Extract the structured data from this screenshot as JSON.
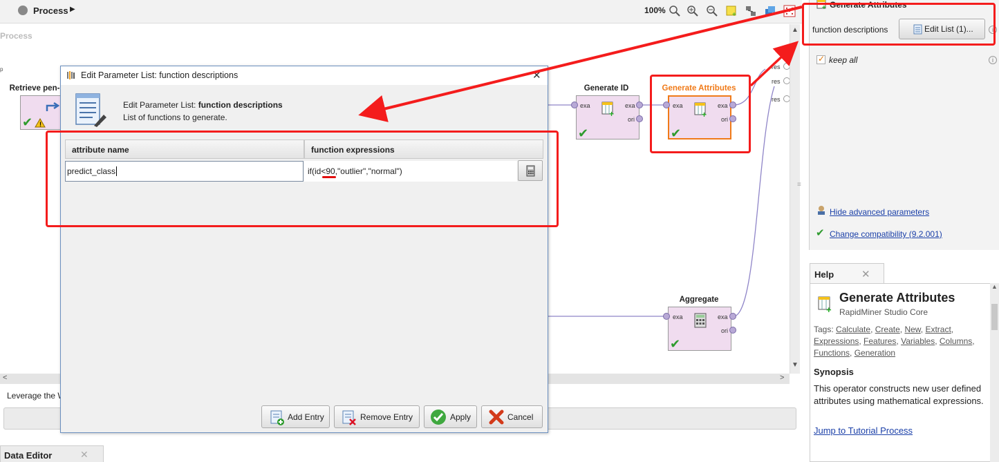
{
  "topbar": {
    "title": "Process",
    "zoom": "100%"
  },
  "canvas": {
    "label": "Process",
    "left_cut_label": "p",
    "operators": {
      "retrieve": {
        "title": "Retrieve pen-"
      },
      "generate_id": {
        "title": "Generate ID",
        "in_port": "exa",
        "out_ports": [
          "exa",
          "ori"
        ]
      },
      "generate_attributes": {
        "title": "Generate Attributes",
        "in_port": "exa",
        "out_ports": [
          "exa",
          "ori"
        ]
      },
      "aggregate": {
        "title": "Aggregate",
        "in_port": "exa",
        "out_ports": [
          "exa",
          "ori"
        ]
      }
    },
    "result_ports": [
      "res",
      "res",
      "res"
    ]
  },
  "bottom": {
    "leverage_text": "Leverage the W",
    "data_editor_tab": "Data Editor"
  },
  "params": {
    "header": "Generate Attributes",
    "function_descriptions_label": "function descriptions",
    "edit_list_button": "Edit List (1)...",
    "keep_all_label": "keep all",
    "keep_all_checked": true,
    "hide_advanced": "Hide advanced parameters",
    "change_compat": "Change compatibility (9.2.001)"
  },
  "help": {
    "tab": "Help",
    "title": "Generate Attributes",
    "subtitle": "RapidMiner Studio Core",
    "tags_prefix": "Tags:",
    "tags": [
      "Calculate",
      "Create",
      "New",
      "Extract",
      "Expressions",
      "Features",
      "Variables",
      "Columns",
      "Functions",
      "Generation"
    ],
    "synopsis_heading": "Synopsis",
    "synopsis": "This operator constructs new user defined attributes using mathematical expressions.",
    "tutorial_link": "Jump to Tutorial Process"
  },
  "dialog": {
    "title": "Edit Parameter List: function descriptions",
    "heading_prefix": "Edit Parameter List: ",
    "heading_bold": "function descriptions",
    "subheading": "List of functions to generate.",
    "columns": [
      "attribute name",
      "function expressions"
    ],
    "rows": [
      {
        "name": "predict_class",
        "expression": "if(id<90,\"outlier\",\"normal\")"
      }
    ],
    "buttons": {
      "add": "Add Entry",
      "remove": "Remove Entry",
      "apply": "Apply",
      "cancel": "Cancel"
    }
  },
  "colors": {
    "annotation_red": "#f41c1c",
    "operator_fill": "#f0dcef",
    "selected_operator": "#f07a18",
    "ok_green": "#2e9b2e"
  }
}
